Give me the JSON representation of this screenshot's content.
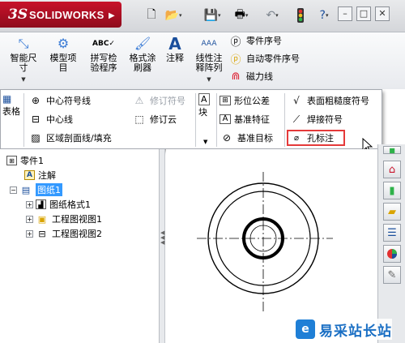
{
  "app": {
    "logo_ds": "3S",
    "logo_text": "SOLIDWORKS"
  },
  "colors": {
    "logo_red": "#c8122a",
    "highlight_border": "#e53a3a",
    "annotation_arrow": "#e53a3a",
    "selection_blue": "#3399ff",
    "watermark_blue": "#1a6fc4"
  },
  "ribbon": {
    "smart_dimension": "智能尺\n寸",
    "model_items": "模型项\n目",
    "spell_check": "拼写检\n验程序",
    "format_painter": "格式涂\n刷器",
    "note": "注释",
    "linear_note_pattern": "线性注\n释阵列",
    "balloon": "零件序号",
    "auto_balloon": "自动零件序号",
    "magnetic_line": "磁力线"
  },
  "panel": {
    "table_label": "表格",
    "block_label": "块",
    "center_mark": "中心符号线",
    "centerline": "中心线",
    "area_hatch": "区域剖面线/填充",
    "revision_symbol": "修订符号",
    "revision_cloud": "修订云",
    "geometric_tolerance": "形位公差",
    "datum_feature": "基准特征",
    "datum_target": "基准目标",
    "surface_finish": "表面粗糙度符号",
    "weld_symbol": "焊接符号",
    "hole_callout": "孔标注"
  },
  "tree": {
    "part": "零件1",
    "annotations": "注解",
    "sheet": "图纸1",
    "sheet_format": "图纸格式1",
    "drawing_view1": "工程图视图1",
    "drawing_view2": "工程图视图2"
  },
  "watermark": {
    "mark": "e",
    "text": "易采站长站"
  }
}
